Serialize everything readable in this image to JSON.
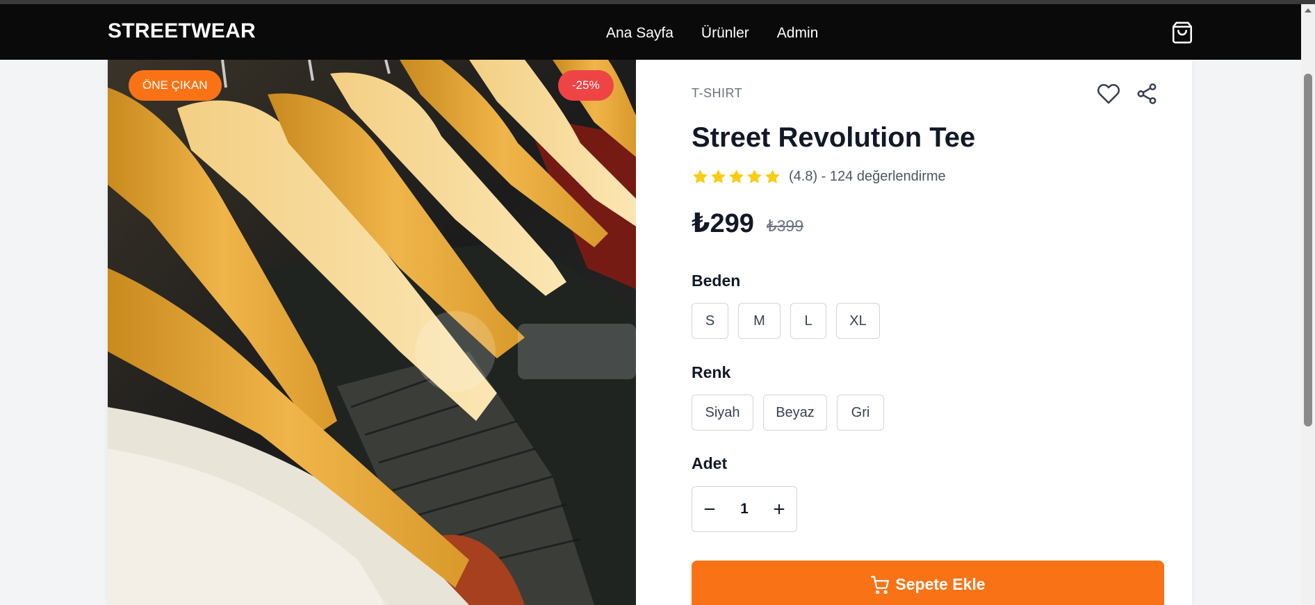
{
  "navbar": {
    "brand": "STREETWEAR",
    "links": [
      "Ana Sayfa",
      "Ürünler",
      "Admin"
    ],
    "cart_icon": "shopping-bag-icon"
  },
  "product": {
    "badges": {
      "featured": "ÖNE ÇIKAN",
      "discount": "-25%"
    },
    "category": "T-SHIRT",
    "title": "Street Revolution Tee",
    "rating": 4.8,
    "rating_text": "(4.8) - 124 değerlendirme",
    "price": "₺299",
    "old_price": "₺399",
    "image_description_icon": "clothes-on-hangers-photo",
    "size": {
      "label": "Beden",
      "options": [
        "S",
        "M",
        "L",
        "XL"
      ]
    },
    "color": {
      "label": "Renk",
      "options": [
        "Siyah",
        "Beyaz",
        "Gri"
      ]
    },
    "quantity": {
      "label": "Adet",
      "value": "1"
    },
    "add_to_cart": "Sepete Ekle"
  },
  "colors": {
    "accent": "#f97316",
    "discount": "#ef4444",
    "star": "#facc15",
    "navbar": "#0a0a0a"
  }
}
